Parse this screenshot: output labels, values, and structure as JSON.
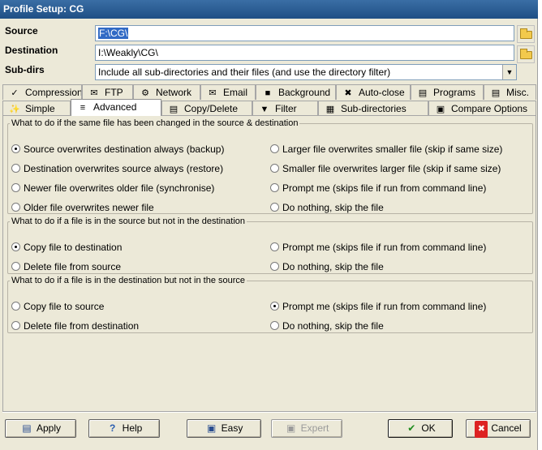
{
  "window": {
    "title": "Profile Setup: CG"
  },
  "fields": {
    "source_label": "Source",
    "source_value": "F:\\CG\\",
    "destination_label": "Destination",
    "destination_value": "I:\\Weakly\\CG\\",
    "subdirs_label": "Sub-dirs",
    "subdirs_value": "Include all sub-directories and their files (and use the directory filter)"
  },
  "tabs_row1": [
    {
      "label": "Compression",
      "icon": "compression-icon"
    },
    {
      "label": "FTP",
      "icon": "ftp-icon"
    },
    {
      "label": "Network",
      "icon": "network-icon"
    },
    {
      "label": "Email",
      "icon": "email-icon"
    },
    {
      "label": "Background",
      "icon": "background-icon"
    },
    {
      "label": "Auto-close",
      "icon": "auto-close-icon"
    },
    {
      "label": "Programs",
      "icon": "programs-icon"
    },
    {
      "label": "Misc.",
      "icon": "misc-icon"
    }
  ],
  "tabs_row2": [
    {
      "label": "Simple",
      "icon": "simple-icon"
    },
    {
      "label": "Advanced",
      "icon": "advanced-icon",
      "active": true
    },
    {
      "label": "Copy/Delete",
      "icon": "copy-delete-icon"
    },
    {
      "label": "Filter",
      "icon": "filter-icon"
    },
    {
      "label": "Sub-directories",
      "icon": "sub-directories-icon"
    },
    {
      "label": "Compare Options",
      "icon": "compare-options-icon"
    }
  ],
  "group1": {
    "legend": "What to do if the same file has been changed in the source & destination",
    "options": [
      {
        "label": "Source overwrites destination always (backup)",
        "checked": true
      },
      {
        "label": "Destination overwrites source always (restore)",
        "checked": false
      },
      {
        "label": "Newer file overwrites older file (synchronise)",
        "checked": false
      },
      {
        "label": "Older file overwrites newer file",
        "checked": false
      },
      {
        "label": "Larger file overwrites smaller file (skip if same size)",
        "checked": false
      },
      {
        "label": "Smaller file overwrites larger file (skip if same size)",
        "checked": false
      },
      {
        "label": "Prompt me  (skips file if run from command line)",
        "checked": false
      },
      {
        "label": "Do nothing, skip the file",
        "checked": false
      }
    ]
  },
  "group2": {
    "legend": "What to do if a file is in the source but not in the destination",
    "options": [
      {
        "label": "Copy file to destination",
        "checked": true
      },
      {
        "label": "Delete file from source",
        "checked": false
      },
      {
        "label": "Prompt me  (skips file if run from command line)",
        "checked": false
      },
      {
        "label": "Do nothing, skip the file",
        "checked": false
      }
    ]
  },
  "group3": {
    "legend": "What to do if a file is in the destination but not in the source",
    "options": [
      {
        "label": "Copy file to source",
        "checked": false
      },
      {
        "label": "Delete file from destination",
        "checked": false
      },
      {
        "label": "Prompt me  (skips file if run from command line)",
        "checked": true
      },
      {
        "label": "Do nothing, skip the file",
        "checked": false
      }
    ]
  },
  "buttons": {
    "apply": "Apply",
    "help": "Help",
    "easy": "Easy",
    "expert": "Expert",
    "ok": "OK",
    "cancel": "Cancel"
  }
}
